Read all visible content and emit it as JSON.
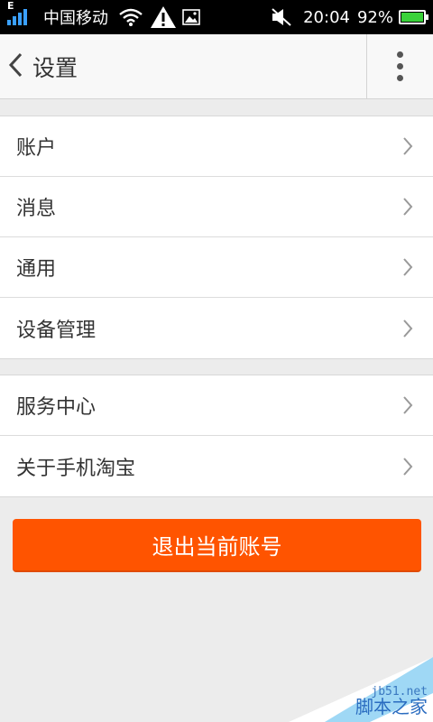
{
  "status_bar": {
    "network_type": "E",
    "carrier": "中国移动",
    "time": "20:04",
    "battery_percent": "92%",
    "battery_level": 0.92,
    "icons": [
      "signal-icon",
      "wifi-icon",
      "warning-icon",
      "image-icon",
      "mute-icon",
      "battery-icon"
    ]
  },
  "header": {
    "title": "设置",
    "back_icon": "chevron-left-icon",
    "menu_icon": "more-vert-icon"
  },
  "groups": [
    {
      "items": [
        {
          "label": "账户"
        },
        {
          "label": "消息"
        },
        {
          "label": "通用"
        },
        {
          "label": "设备管理"
        }
      ]
    },
    {
      "items": [
        {
          "label": "服务中心"
        },
        {
          "label": "关于手机淘宝"
        }
      ]
    }
  ],
  "logout_button": {
    "label": "退出当前账号",
    "color": "#ff5400"
  },
  "watermark": {
    "small": "jb51.net",
    "big": "脚本之家"
  },
  "colors": {
    "accent": "#ff5400",
    "background": "#ececec"
  }
}
